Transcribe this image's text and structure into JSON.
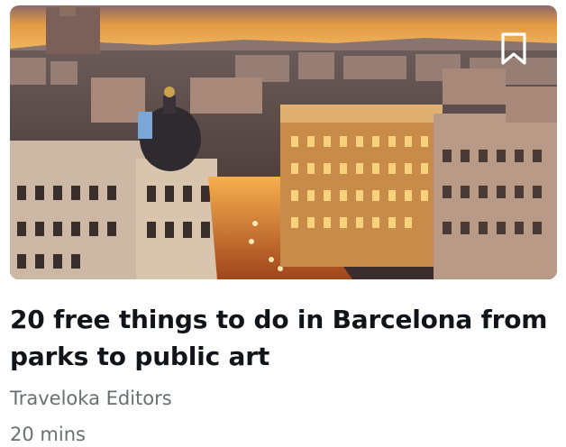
{
  "article": {
    "title": "20 free things to do in Barcelona from parks to public art",
    "author": "Traveloka Editors",
    "duration": "20 mins",
    "image_alt": "Aerial view of city buildings at sunset"
  },
  "icons": {
    "bookmark": "bookmark-icon"
  },
  "colors": {
    "title": "#111418",
    "meta": "#6b6e72",
    "sky_top": "#d98a3c",
    "sky_bottom": "#f0b04a"
  }
}
